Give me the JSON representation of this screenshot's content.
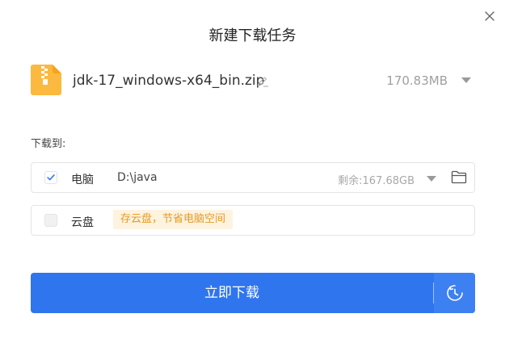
{
  "dialog": {
    "title": "新建下载任务"
  },
  "file": {
    "name": "jdk-17_windows-x64_bin.zip",
    "size": "170.83MB",
    "icon": "zip-file-icon"
  },
  "save_to": {
    "label": "下载到:",
    "pc": {
      "checked": true,
      "name": "电脑",
      "path": "D:\\java",
      "free_space": "剩余:167.68GB"
    },
    "cloud": {
      "checked": false,
      "name": "云盘",
      "promo": "存云盘，节省电脑空间"
    }
  },
  "actions": {
    "download_label": "立即下载",
    "schedule_icon": "clock-icon"
  },
  "colors": {
    "primary": "#2f75ee",
    "file_icon": "#fbb93f",
    "checkbox_check": "#2f75ee",
    "promo_bg": "#fdf3df",
    "promo_text": "#e59a27"
  }
}
